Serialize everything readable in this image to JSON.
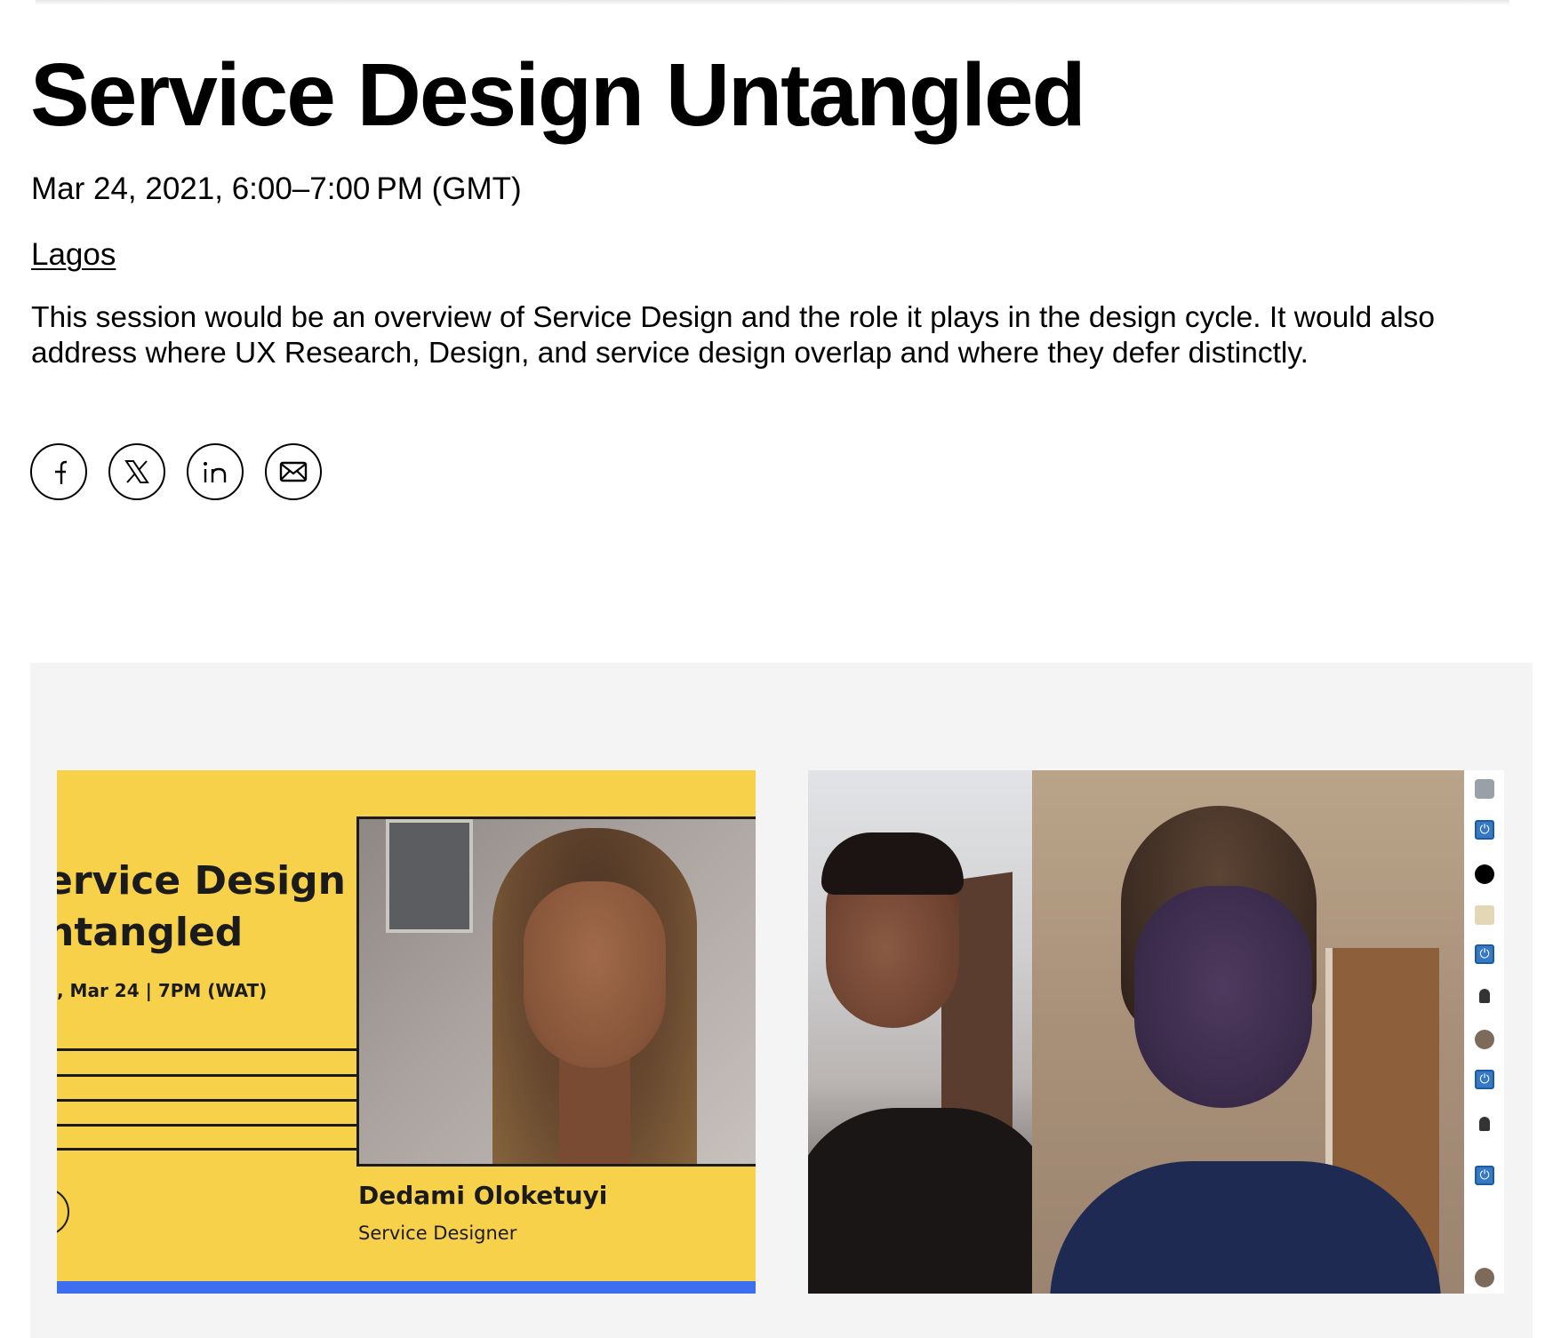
{
  "event": {
    "title": "Service Design Untangled",
    "datetime": "Mar 24, 2021, 6:00–7:00 PM (GMT)",
    "location": "Lagos",
    "description": "This session would be an overview of Service Design and the role it plays in the design cycle. It would also address where UX Research, Design, and service design overlap and where they defer distinctly."
  },
  "share": {
    "buttons": [
      {
        "name": "facebook",
        "icon": "facebook-icon"
      },
      {
        "name": "x",
        "icon": "x-icon"
      },
      {
        "name": "linkedin",
        "icon": "linkedin-icon"
      },
      {
        "name": "email",
        "icon": "mail-icon"
      }
    ]
  },
  "gallery": {
    "flyer": {
      "title_line1": "ervice Design",
      "title_line2": "ntangled",
      "date": ", Mar 24 | 7PM (WAT)",
      "speaker_name": "Dedami Oloketuyi",
      "speaker_role": "Service Designer",
      "colors": {
        "background": "#f7d14a",
        "accent_bar": "#3d6ef0",
        "text": "#1c1b1b"
      }
    },
    "call_screenshot": {
      "participant_strip": [
        "avatar",
        "power-icon",
        "dot",
        "person",
        "power-icon",
        "person-small",
        "avatar-round",
        "power-icon",
        "person-small",
        "power-icon",
        "avatar-round"
      ]
    }
  }
}
